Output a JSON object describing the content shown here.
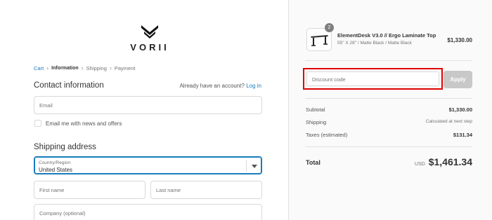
{
  "brand": {
    "name": "VORII"
  },
  "breadcrumb": [
    {
      "label": "Cart",
      "state": "link"
    },
    {
      "label": "Information",
      "state": "current"
    },
    {
      "label": "Shipping",
      "state": "upcoming"
    },
    {
      "label": "Payment",
      "state": "upcoming"
    }
  ],
  "contact": {
    "heading": "Contact information",
    "account_prompt": "Already have an account?",
    "login_label": "Log in",
    "email_placeholder": "Email",
    "newsletter_label": "Email me with news and offers"
  },
  "shipping": {
    "heading": "Shipping address",
    "country_label": "Country/Region",
    "country_value": "United States",
    "first_name_placeholder": "First name",
    "last_name_placeholder": "Last name",
    "company_placeholder": "Company (optional)"
  },
  "order": {
    "product": {
      "quantity": "2",
      "name": "ElementDesk V3.0 // Ergo Laminate Top",
      "variant": "55\" X 28\" / Matte Black / Matte Black",
      "price": "$1,330.00"
    },
    "discount_placeholder": "Discount code",
    "apply_label": "Apply",
    "subtotal_label": "Subtotal",
    "subtotal_value": "$1,330.00",
    "shipping_label": "Shipping",
    "shipping_value": "Calculated at next step",
    "taxes_label": "Taxes (estimated)",
    "taxes_value": "$131.34",
    "total_label": "Total",
    "currency": "USD",
    "total_value": "$1,461.34"
  },
  "colors": {
    "link": "#197bbd",
    "highlight": "#e00000",
    "apply_bg": "#c8c8c8"
  }
}
